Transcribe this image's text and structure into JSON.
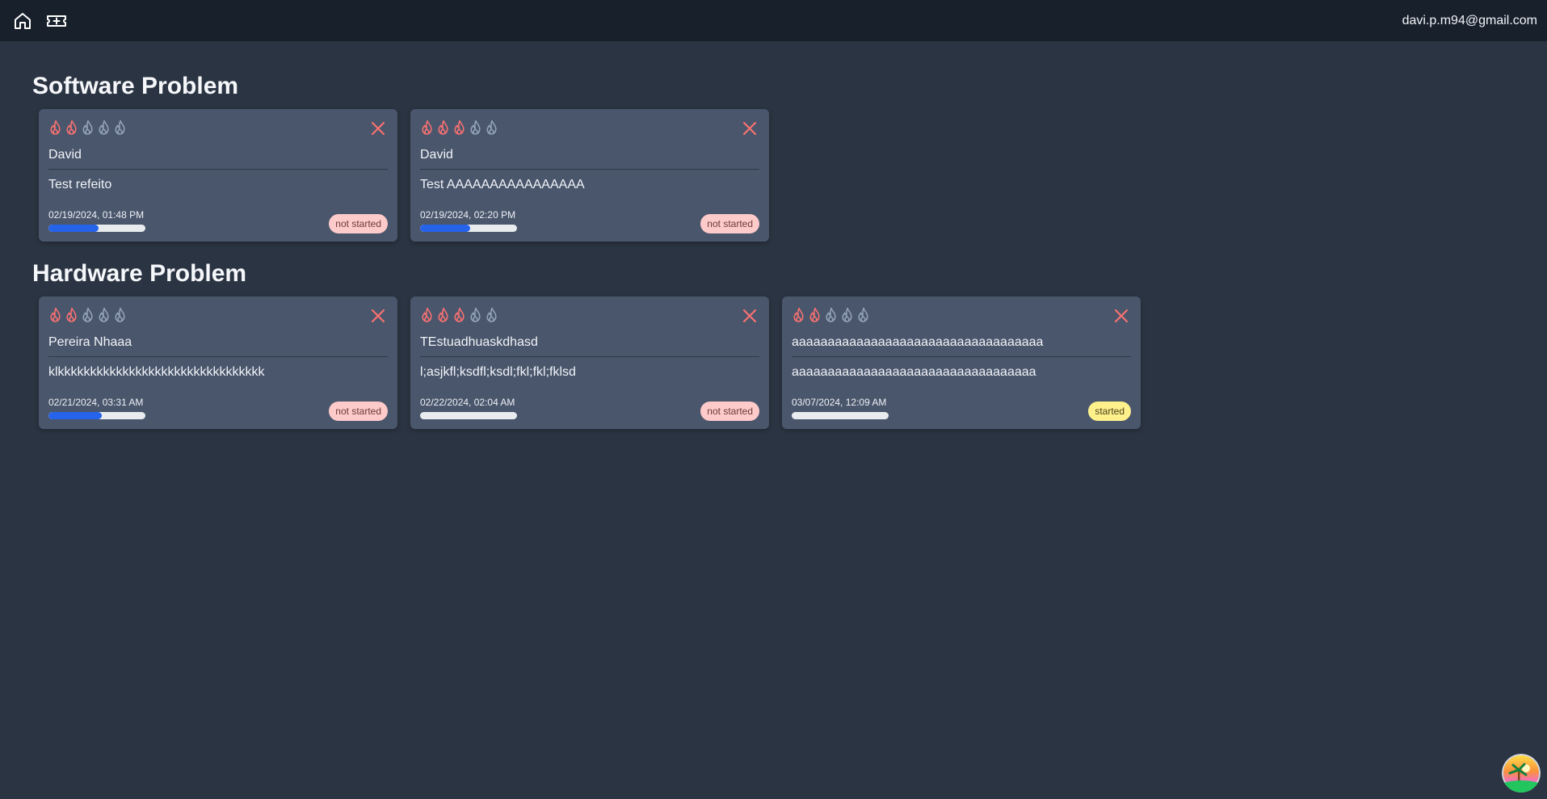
{
  "header": {
    "home_icon": "home-icon",
    "tickets_icon": "ticket-plus-icon",
    "user_email": "davi.p.m94@gmail.com"
  },
  "colors": {
    "flame_active": "#f87171",
    "flame_inactive": "#94a3b8",
    "progress_fill": "#2563eb",
    "close": "#f87171"
  },
  "sections": [
    {
      "title": "Software Problem",
      "cards": [
        {
          "priority": 2,
          "name": "David",
          "description": "Test refeito",
          "date": "02/19/2024, 01:48 PM",
          "progress": 0.52,
          "status": "not started",
          "status_kind": "not-started"
        },
        {
          "priority": 3,
          "name": "David",
          "description": "Test AAAAAAAAAAAAAAAA",
          "date": "02/19/2024, 02:20 PM",
          "progress": 0.52,
          "status": "not started",
          "status_kind": "not-started"
        }
      ]
    },
    {
      "title": "Hardware Problem",
      "cards": [
        {
          "priority": 2,
          "name": "Pereira Nhaaa",
          "description": "klkkkkkkkkkkkkkkkkkkkkkkkkkkkkkkkk",
          "date": "02/21/2024, 03:31 AM",
          "progress": 0.55,
          "status": "not started",
          "status_kind": "not-started"
        },
        {
          "priority": 3,
          "name": "TEstuadhuaskdhasd",
          "description": "l;asjkfl;ksdfl;ksdl;fkl;fkl;fklsd",
          "date": "02/22/2024, 02:04 AM",
          "progress": 0,
          "status": "not started",
          "status_kind": "not-started"
        },
        {
          "priority": 2,
          "name": "aaaaaaaaaaaaaaaaaaaaaaaaaaaaaaaaaaa",
          "description": "aaaaaaaaaaaaaaaaaaaaaaaaaaaaaaaaaa",
          "date": "03/07/2024, 12:09 AM",
          "progress": 0,
          "status": "started",
          "status_kind": "started"
        }
      ]
    }
  ]
}
